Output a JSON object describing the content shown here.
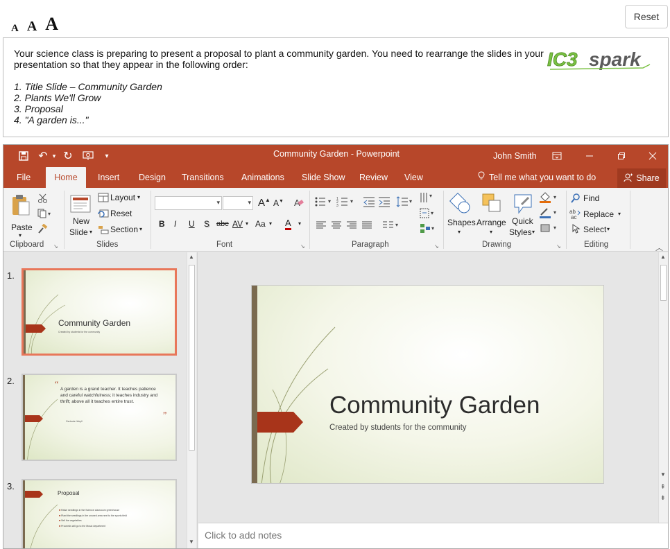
{
  "font_size_controls": [
    "A",
    "A",
    "A"
  ],
  "reset_label": "Reset",
  "instructions": {
    "text": "Your science class is preparing to present a proposal to plant a community garden. You need to rearrange the slides in your presentation so that they appear in the following order:",
    "order": [
      "1. Title Slide – Community Garden",
      "2. Plants We'll Grow",
      "3. Proposal",
      "4. \"A garden is...\""
    ],
    "logo_text": "IC3spark",
    "logo_colors": {
      "ic3": "#7ac143",
      "spark": "#555555"
    }
  },
  "window": {
    "title": "Community Garden - Powerpoint",
    "user": "John Smith",
    "accent": "#b7472a",
    "qat_icons": [
      "save-icon",
      "undo-icon",
      "redo-icon",
      "present-icon",
      "customize-icon"
    ]
  },
  "tabs": [
    "File",
    "Home",
    "Insert",
    "Design",
    "Transitions",
    "Animations",
    "Slide Show",
    "Review",
    "View"
  ],
  "tell_me": "Tell me what you want to do",
  "share_label": "Share",
  "ribbon": {
    "clipboard": {
      "label": "Clipboard",
      "paste": "Paste"
    },
    "slides": {
      "label": "Slides",
      "new_slide": "New",
      "new_slide2": "Slide",
      "layout": "Layout",
      "reset": "Reset",
      "section": "Section"
    },
    "font": {
      "label": "Font",
      "bold": "B",
      "italic": "I",
      "underline": "U",
      "shadow": "S",
      "strike": "abc",
      "spacing": "AV",
      "case": "Aa",
      "grow": "A",
      "shrink": "A",
      "color": "A"
    },
    "paragraph": {
      "label": "Paragraph"
    },
    "drawing": {
      "label": "Drawing",
      "shapes": "Shapes",
      "arrange": "Arrange",
      "quick": "Quick",
      "styles": "Styles"
    },
    "editing": {
      "label": "Editing",
      "find": "Find",
      "replace": "Replace",
      "select": "Select"
    }
  },
  "slides": [
    {
      "number": "1.",
      "title": "Community Garden",
      "subtitle": "Created by students for the community"
    },
    {
      "number": "2.",
      "quote": "A garden is a grand teacher. It teaches patience and careful watchfulness; it teaches industry and thrift; above all it teaches entire trust.",
      "attribution": "Gertrude Jekyll",
      "open_quote": "“",
      "close_quote": "”"
    },
    {
      "number": "3.",
      "title": "Proposal",
      "bullets": [
        "Raise seedlings in the Science classroom greenhouse",
        "Plant the seedlings in the unused area next to the sports field",
        "Sell the vegetables",
        "Proceeds will go to the Music department"
      ]
    }
  ],
  "main_slide": {
    "title": "Community Garden",
    "subtitle": "Created by students for the community"
  },
  "notes_placeholder": "Click to add notes"
}
